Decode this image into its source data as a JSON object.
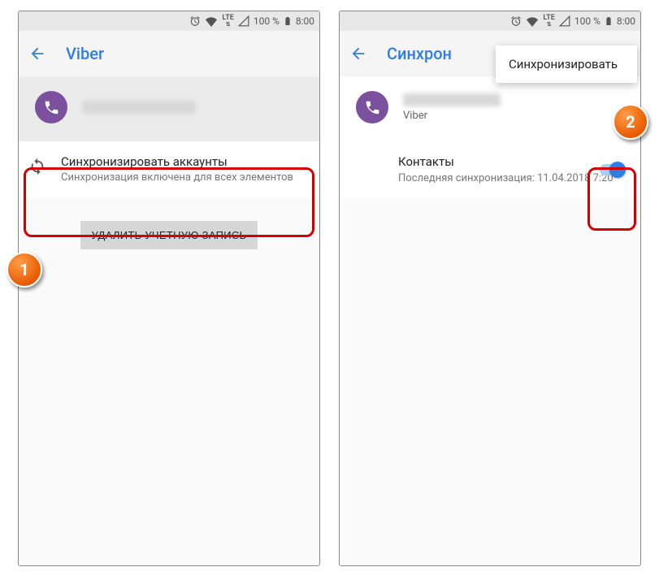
{
  "statusbar": {
    "battery": "100 %",
    "time": "8:00"
  },
  "screen1": {
    "title": "Viber",
    "sync": {
      "title": "Синхронизировать аккаунты",
      "subtitle": "Синхронизация включена для всех элементов"
    },
    "delete_label": "УДАЛИТЬ УЧЕТНУЮ ЗАПИСЬ"
  },
  "screen2": {
    "title": "Синхрон",
    "popup": "Синхронизировать",
    "account_sub": "Viber",
    "contacts": {
      "title": "Контакты",
      "subtitle": "Последняя синхронизация: 11.04.2018 7:20"
    }
  },
  "steps": {
    "one": "1",
    "two": "2"
  }
}
